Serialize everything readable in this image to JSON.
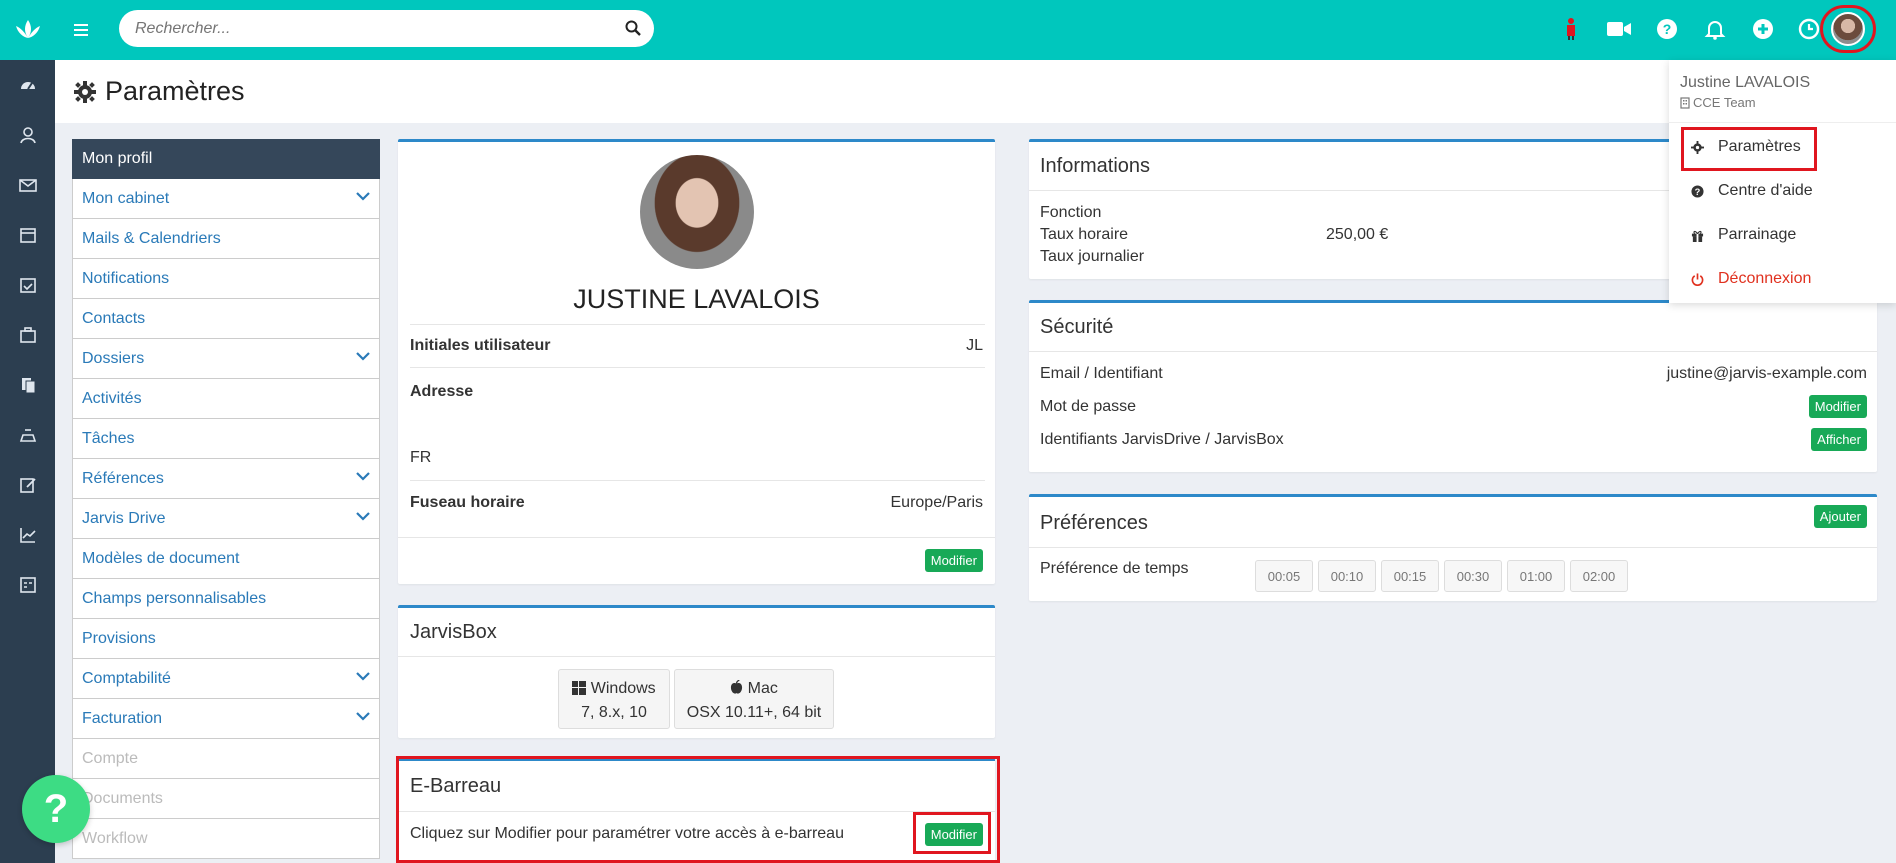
{
  "search": {
    "placeholder": "Rechercher..."
  },
  "page": {
    "title": "Paramètres"
  },
  "menu": [
    {
      "label": "Mon profil",
      "state": "active",
      "chevron": false
    },
    {
      "label": "Mon cabinet",
      "state": "normal",
      "chevron": true
    },
    {
      "label": "Mails & Calendriers",
      "state": "normal",
      "chevron": false
    },
    {
      "label": "Notifications",
      "state": "normal",
      "chevron": false
    },
    {
      "label": "Contacts",
      "state": "normal",
      "chevron": false
    },
    {
      "label": "Dossiers",
      "state": "normal",
      "chevron": true
    },
    {
      "label": "Activités",
      "state": "normal",
      "chevron": false
    },
    {
      "label": "Tâches",
      "state": "normal",
      "chevron": false
    },
    {
      "label": "Références",
      "state": "normal",
      "chevron": true
    },
    {
      "label": "Jarvis Drive",
      "state": "normal",
      "chevron": true
    },
    {
      "label": "Modèles de document",
      "state": "normal",
      "chevron": false
    },
    {
      "label": "Champs personnalisables",
      "state": "normal",
      "chevron": false
    },
    {
      "label": "Provisions",
      "state": "normal",
      "chevron": false
    },
    {
      "label": "Comptabilité",
      "state": "normal",
      "chevron": true
    },
    {
      "label": "Facturation",
      "state": "normal",
      "chevron": true
    },
    {
      "label": "Compte",
      "state": "disabled",
      "chevron": false
    },
    {
      "label": "Documents",
      "state": "disabled",
      "chevron": false
    },
    {
      "label": "Workflow",
      "state": "disabled",
      "chevron": false
    }
  ],
  "profile": {
    "name": "JUSTINE LAVALOIS",
    "initials_label": "Initiales utilisateur",
    "initials_value": "JL",
    "address_label": "Adresse",
    "address_country": "FR",
    "timezone_label": "Fuseau horaire",
    "timezone_value": "Europe/Paris",
    "edit_label": "Modifier"
  },
  "jarvisbox": {
    "title": "JarvisBox",
    "windows_label": "Windows",
    "windows_versions": "7, 8.x, 10",
    "mac_label": "Mac",
    "mac_versions": "OSX 10.11+, 64 bit"
  },
  "ebarreau": {
    "title": "E-Barreau",
    "text": "Cliquez sur Modifier pour paramétrer votre accès à e-barreau",
    "edit_label": "Modifier"
  },
  "informations": {
    "title": "Informations",
    "fonction_label": "Fonction",
    "taux_horaire_label": "Taux horaire",
    "taux_horaire_value": "250,00 €",
    "taux_journalier_label": "Taux journalier"
  },
  "securite": {
    "title": "Sécurité",
    "email_label": "Email / Identifiant",
    "email_value": "justine@jarvis-example.com",
    "password_label": "Mot de passe",
    "password_btn": "Modifier",
    "drive_label": "Identifiants JarvisDrive / JarvisBox",
    "drive_btn": "Afficher"
  },
  "preferences": {
    "title": "Préférences",
    "add_label": "Ajouter",
    "time_label": "Préférence de temps",
    "times": [
      "00:05",
      "00:10",
      "00:15",
      "00:30",
      "01:00",
      "02:00"
    ]
  },
  "user_dropdown": {
    "name": "Justine LAVALOIS",
    "team": "CCE Team",
    "settings": "Paramètres",
    "help": "Centre d'aide",
    "referral": "Parrainage",
    "logout": "Déconnexion"
  },
  "colors": {
    "brand": "#00c7bd",
    "rail": "#2c3e50",
    "link": "#2a7ab8",
    "accent": "#2d89c9",
    "green": "#18a957",
    "highlight": "#e0161f"
  }
}
